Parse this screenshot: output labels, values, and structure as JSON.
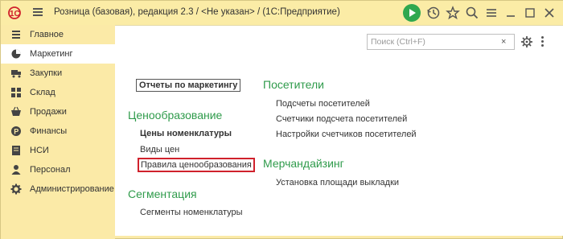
{
  "window": {
    "title": "Розница (базовая), редакция 2.3 / <Не указан> /  (1С:Предприятие)",
    "brand_color": "#fbeaa7",
    "accent_green": "#2fa84f"
  },
  "sidebar": {
    "items": [
      {
        "label": "Главное",
        "icon": "menu-lines-icon"
      },
      {
        "label": "Маркетинг",
        "icon": "pie-chart-icon",
        "active": true
      },
      {
        "label": "Закупки",
        "icon": "truck-icon"
      },
      {
        "label": "Склад",
        "icon": "warehouse-grid-icon"
      },
      {
        "label": "Продажи",
        "icon": "basket-icon"
      },
      {
        "label": "Финансы",
        "icon": "coin-icon"
      },
      {
        "label": "НСИ",
        "icon": "book-icon"
      },
      {
        "label": "Персонал",
        "icon": "person-icon"
      },
      {
        "label": "Администрирование",
        "icon": "gear-icon"
      }
    ]
  },
  "search": {
    "placeholder": "Поиск (Ctrl+F)",
    "clear": "×"
  },
  "content": {
    "reports_link": "Отчеты по маркетингу",
    "pricing": {
      "title": "Ценообразование",
      "items": [
        "Цены номенклатуры",
        "Виды цен",
        "Правила ценообразования"
      ]
    },
    "segmentation": {
      "title": "Сегментация",
      "items": [
        "Сегменты номенклатуры"
      ]
    },
    "visitors": {
      "title": "Посетители",
      "items": [
        "Подсчеты посетителей",
        "Счетчики подсчета посетителей",
        "Настройки счетчиков посетителей"
      ]
    },
    "merch": {
      "title": "Мерчандайзинг",
      "items": [
        "Установка площади выкладки"
      ]
    }
  }
}
